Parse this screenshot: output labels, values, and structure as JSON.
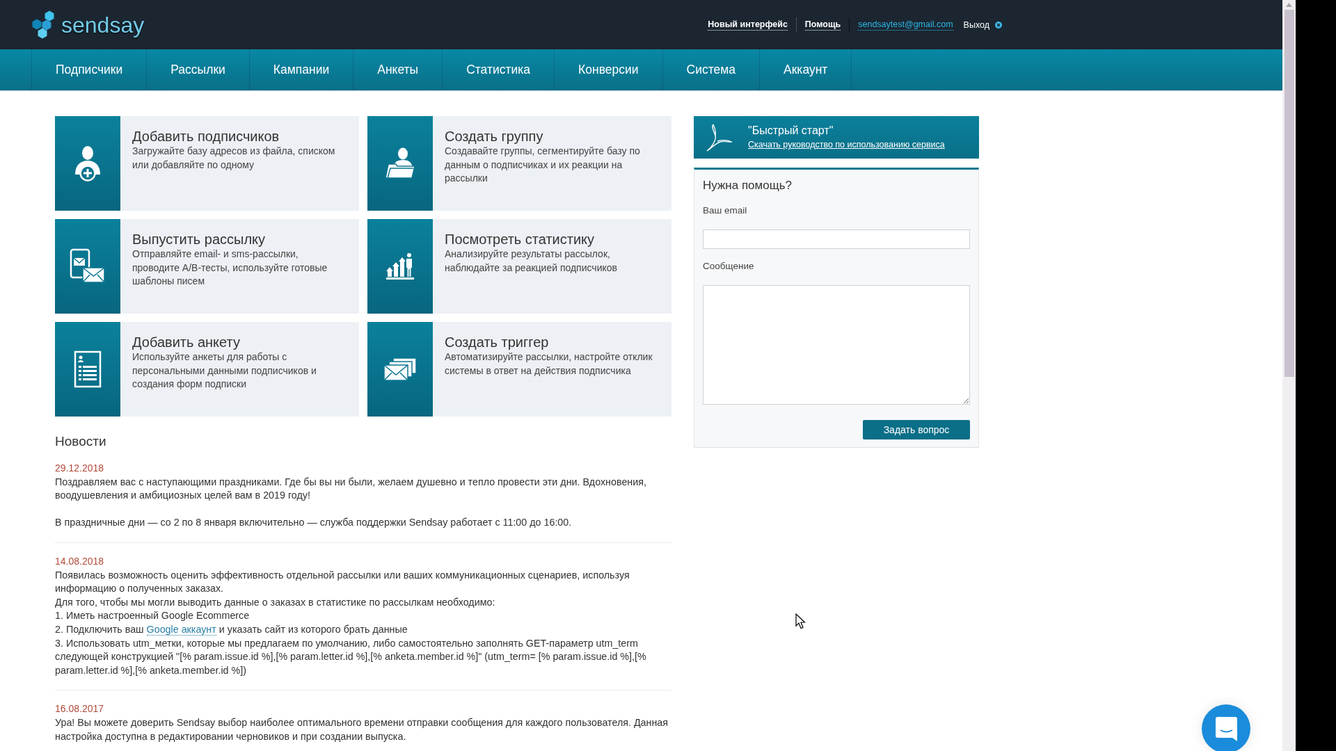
{
  "header": {
    "logo": "sendsay",
    "links": [
      {
        "label": "Новый интерфейс",
        "kind": "bold"
      },
      {
        "label": "Помощь",
        "kind": "bold"
      },
      {
        "label": "sendsaytest@gmail.com",
        "kind": "email"
      },
      {
        "label": "Выход",
        "kind": "logout"
      }
    ]
  },
  "nav": [
    {
      "label": "Подписчики",
      "selected": false
    },
    {
      "label": "Рассылки",
      "selected": false
    },
    {
      "label": "Кампании",
      "selected": false
    },
    {
      "label": "Анкеты",
      "selected": false
    },
    {
      "label": "Статистика",
      "selected": false
    },
    {
      "label": "Конверсии",
      "selected": false
    },
    {
      "label": "Система",
      "selected": false
    },
    {
      "label": "Аккаунт",
      "selected": false
    }
  ],
  "tiles": [
    {
      "title": "Добавить подписчиков",
      "description": "Загружайте базу адресов из файла, списком или добавляйте по одному"
    },
    {
      "title": "Создать группу",
      "description": "Создавайте группы, сегментируйте базу по данным о подписчиках и их реакции на рассылки"
    },
    {
      "title": "Выпустить рассылку",
      "description": "Отправляйте email- и sms-рассылки, проводите A/B-тесты, используйте готовые шаблоны писем"
    },
    {
      "title": "Посмотреть статистику",
      "description": "Анализируйте результаты рассылок, наблюдайте за реакцией подписчиков"
    },
    {
      "title": "Добавить анкету",
      "description": "Используйте анкеты для работы с персональными данными подписчиков и создания форм подписки"
    },
    {
      "title": "Создать триггер",
      "description": "Автоматизируйте рассылки, настройте отклик системы в ответ на действия подписчика"
    }
  ],
  "news": {
    "title": "Новости",
    "items": [
      {
        "date": "29.12.2018",
        "blocks": [
          [
            {
              "parts": [
                {
                  "kind": "text",
                  "text": "Поздравляем вас с наступающими праздниками. Где бы вы ни были, желаем душевно и тепло провести эти дни. Вдохновения, воодушевления и амбициозных целей вам в 2019 году!"
                }
              ]
            }
          ],
          [
            {
              "parts": [
                {
                  "kind": "text",
                  "text": "В праздничные дни — со 2 по 8 января включительно — служба поддержки Sendsay работает с 11:00 до 16:00."
                }
              ]
            }
          ]
        ]
      },
      {
        "date": "14.08.2018",
        "blocks": [
          [
            {
              "parts": [
                {
                  "kind": "text",
                  "text": "Появилась возможность оценить эффективность отдельной рассылки или ваших коммуникационных сценариев, используя информацию о полученных заказах."
                }
              ]
            },
            {
              "parts": [
                {
                  "kind": "text",
                  "text": "Для того, чтобы мы могли выводить данные о заказах в статистике по рассылкам необходимо:"
                }
              ]
            },
            {
              "parts": [
                {
                  "kind": "text",
                  "text": "1. Иметь настроенный Google Ecommerce"
                }
              ]
            },
            {
              "parts": [
                {
                  "kind": "text",
                  "text": "2. Подключить ваш"
                },
                {
                  "kind": "link",
                  "text": "Google аккаунт"
                },
                {
                  "kind": "text",
                  "text": "и указать сайт из которого брать данные"
                }
              ]
            },
            {
              "parts": [
                {
                  "kind": "text",
                  "text": "3. Использовать utm_метки, которые мы предлагаем по умолчанию, либо самостоятельно заполнять GET-параметр utm_term следующей конструкцией \"[% param.issue.id %],[% param.letter.id %],[% anketa.member.id %]\" (utm_term= [% param.issue.id %],[% param.letter.id %],[% anketa.member.id %])"
                }
              ]
            }
          ]
        ]
      },
      {
        "date": "16.08.2017",
        "blocks": [
          [
            {
              "parts": [
                {
                  "kind": "text",
                  "text": "Ура! Вы можете доверить Sendsay выбор наиболее оптимального времени отправки сообщения для каждого пользователя. Данная настройка доступна в редактировании черновиков и при создании выпуска."
                }
              ]
            }
          ]
        ]
      }
    ]
  },
  "quick_start": {
    "title": "\"Быстрый старт\"",
    "link": "Скачать руководство по использованию сервиса"
  },
  "help_form": {
    "title": "Нужна помощь?",
    "fields": [
      {
        "label": "Ваш email",
        "kind": "input"
      },
      {
        "label": "Сообщение",
        "kind": "textarea"
      }
    ],
    "submit": "Задать вопрос"
  }
}
